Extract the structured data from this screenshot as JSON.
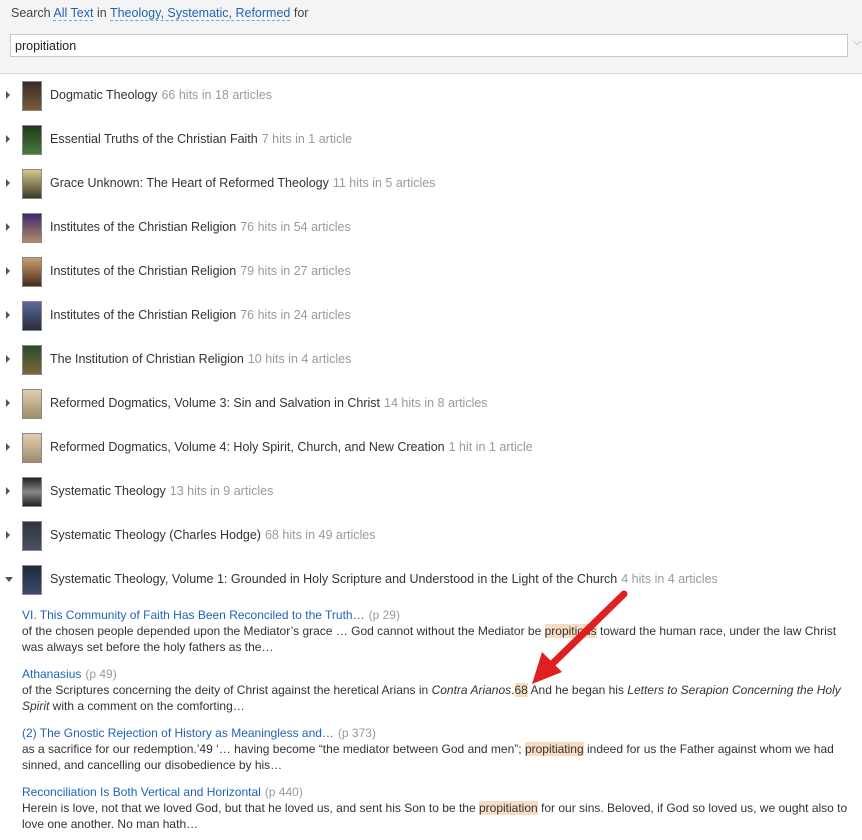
{
  "search": {
    "prefix": "Search",
    "scope": "All Text",
    "in_word": "in",
    "collection": "Theology, Systematic, Reformed",
    "for_word": "for",
    "query": "propitiation"
  },
  "books": [
    {
      "title": "Dogmatic Theology",
      "hits": "66 hits in 18 articles",
      "cover": "#6b4a4a"
    },
    {
      "title": "Essential Truths of the Christian Faith",
      "hits": "7 hits in 1 article",
      "cover": "#2f5a2a"
    },
    {
      "title": "Grace Unknown: The Heart of Reformed Theology",
      "hits": "11 hits in 5 articles",
      "cover": "#3b3a22"
    },
    {
      "title": "Institutes of the Christian Religion",
      "hits": "76 hits in 54 articles",
      "cover": "#5a3b6e"
    },
    {
      "title": "Institutes of the Christian Religion",
      "hits": "79 hits in 27 articles",
      "cover": "#6e4a30"
    },
    {
      "title": "Institutes of the Christian Religion",
      "hits": "76 hits in 24 articles",
      "cover": "#3e4a6a"
    },
    {
      "title": "The Institution of Christian Religion",
      "hits": "10 hits in 4 articles",
      "cover": "#2f4a2a"
    },
    {
      "title": "Reformed Dogmatics, Volume 3: Sin and Salvation in Christ",
      "hits": "14 hits in 8 articles",
      "cover": "#c9b89a"
    },
    {
      "title": "Reformed Dogmatics, Volume 4: Holy Spirit, Church, and New Creation",
      "hits": "1 hit in 1 article",
      "cover": "#c9b89a"
    },
    {
      "title": "Systematic Theology",
      "hits": "13 hits in 9 articles",
      "cover": "#3a3a3a"
    },
    {
      "title": "Systematic Theology (Charles Hodge)",
      "hits": "68 hits in 49 articles",
      "cover": "#2e3440"
    },
    {
      "title": "Systematic Theology, Volume 1: Grounded in Holy Scripture and Understood in the Light of the Church",
      "hits": "4 hits in 4 articles",
      "cover": "#1e2a3a"
    }
  ],
  "snippets": [
    {
      "title": "VI. This Community of Faith Has Been Reconciled to the Truth…",
      "page": "(p 29)",
      "pre": "of the chosen people depended upon the Mediator’s grace … God cannot without the Mediator be ",
      "hl": "propitious",
      "post": " toward the human race, under the law Christ was always set before the holy fathers as the…"
    },
    {
      "title": "Athanasius",
      "page": "(p 49)",
      "pre": "of the Scriptures concerning the deity of Christ against the heretical Arians in ",
      "italic1": "Contra Arianos",
      "dot": ".",
      "hl": "68",
      "mid": " And he began his ",
      "italic2": "Letters to Serapion Concerning the Holy Spirit",
      "post": " with a comment on the comforting…"
    },
    {
      "title": "(2) The Gnostic Rejection of History as Meaningless and…",
      "page": "(p 373)",
      "pre": "as a sacrifice for our redemption.’49 ‘… having become “the mediator between God and men”; ",
      "hl": "propitiating",
      "post": " indeed for us the Father against whom we had sinned, and cancelling our disobedience by his…"
    },
    {
      "title": "Reconciliation Is Both Vertical and Horizontal",
      "page": "(p 440)",
      "pre": "Herein is love, not that we loved God, but that he loved us, and sent his Son to be the ",
      "hl": "propitiation",
      "post": " for our sins. Beloved, if God so loved us, we ought also to love one another. No man hath…"
    }
  ],
  "colors": {
    "accent": "#1f63b8",
    "highlight": "#f8dcc4",
    "arrow": "#e02020"
  }
}
